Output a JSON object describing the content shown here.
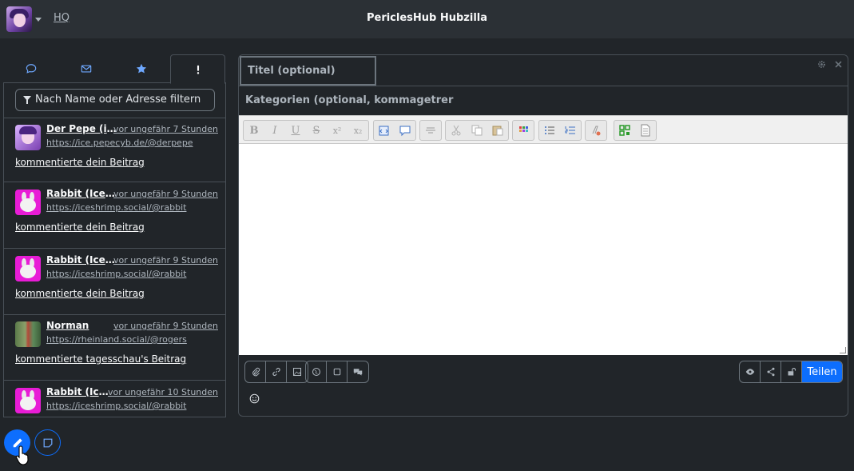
{
  "navbar": {
    "hq_link": "HQ",
    "site_title": "PericlesHub Hubzilla"
  },
  "left_panel": {
    "tabs": [
      {
        "name": "conversations",
        "icon": "chat-icon"
      },
      {
        "name": "mail",
        "icon": "envelope-icon"
      },
      {
        "name": "starred",
        "icon": "star-icon"
      },
      {
        "name": "notifications",
        "icon": "exclamation-icon",
        "active": true
      }
    ],
    "filter_placeholder": "Nach Name oder Adresse filtern",
    "notifications": [
      {
        "name": "Der Pepe (ic...",
        "time": "vor ungefähr 7 Stunden",
        "url": "https://ice.pepecyb.de/@derpepe",
        "message": "kommentierte dein Beitrag",
        "avatar": "pepe"
      },
      {
        "name": "Rabbit (Ices...",
        "time": "vor ungefähr 9 Stunden",
        "url": "https://iceshrimp.social/@rabbit",
        "message": "kommentierte dein Beitrag",
        "avatar": "rabbit"
      },
      {
        "name": "Rabbit (Ices...",
        "time": "vor ungefähr 9 Stunden",
        "url": "https://iceshrimp.social/@rabbit",
        "message": "kommentierte dein Beitrag",
        "avatar": "rabbit"
      },
      {
        "name": "Norman",
        "time": "vor ungefähr 9 Stunden",
        "url": "https://rheinland.social/@rogers",
        "message": "kommentierte tagesschau's Beitrag",
        "avatar": "norman"
      },
      {
        "name": "Rabbit (Ice...",
        "time": "vor ungefähr 10 Stunden",
        "url": "https://iceshrimp.social/@rabbit",
        "message": "",
        "avatar": "rabbit"
      }
    ]
  },
  "editor": {
    "title_placeholder": "Titel (optional)",
    "categories_placeholder": "Kategorien (optional, kommagetrer",
    "toolbar": {
      "bold": "B",
      "italic": "I",
      "underline": "U",
      "strike": "S",
      "sup": "x²",
      "sub": "x₂"
    },
    "share_label": "Teilen"
  },
  "colors": {
    "primary": "#0d6efd",
    "background": "#212529",
    "navbar": "#2b3035"
  }
}
